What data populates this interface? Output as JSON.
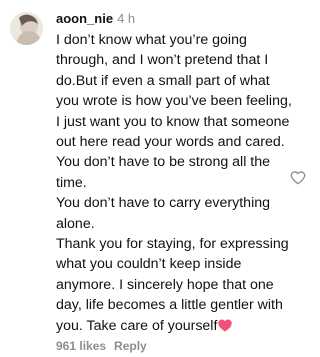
{
  "comment": {
    "username": "aoon_nie",
    "time": "4 h",
    "paragraphs": [
      "I don’t know what you’re going through, and I won’t pretend that I do.But if even a small part of what you wrote is how you’ve been feeling, I just want you to know that someone out here read your words and cared. You don’t have to be strong all the time.",
      "You don’t have to carry everything alone.",
      "Thank you for staying, for expressing what you couldn’t keep inside anymore. I sincerely hope that one day, life becomes a little gentler with you. Take care of yourself"
    ],
    "trailing_emoji": "pink-heart-icon",
    "likes": "961 likes",
    "reply_label": "Reply",
    "like_icon": "heart-outline-icon"
  },
  "colors": {
    "text": "#111111",
    "secondary": "#8e8e8e",
    "pink_heart": "#f2507b"
  }
}
